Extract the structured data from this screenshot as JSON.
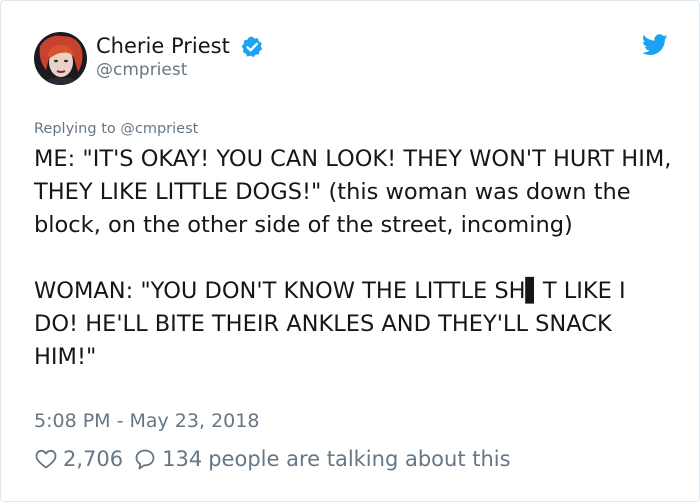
{
  "author": {
    "display_name": "Cherie Priest",
    "handle": "@cmpriest",
    "verified_icon": "verified-badge-icon",
    "brand_color": "#1da1f2"
  },
  "reply": {
    "prefix": "Replying to ",
    "mention": "@cmpriest"
  },
  "tweet": {
    "paragraphs": [
      "ME: \"IT'S OKAY! YOU CAN LOOK! THEY WON'T HURT HIM, THEY LIKE LITTLE DOGS!\" (this woman was down the block, on the other side of the street, incoming)",
      "WOMAN: \"YOU DON'T KNOW THE LITTLE SH▌T LIKE I DO! HE'LL BITE THEIR ANKLES AND THEY'LL SNACK HIM!\""
    ]
  },
  "timestamp": "5:08 PM - May 23, 2018",
  "stats": {
    "likes": "2,706",
    "replies_count": "134",
    "replies_label": "people are talking about this"
  },
  "colors": {
    "text": "#14171a",
    "muted": "#657786",
    "border": "#e1e8ed"
  }
}
